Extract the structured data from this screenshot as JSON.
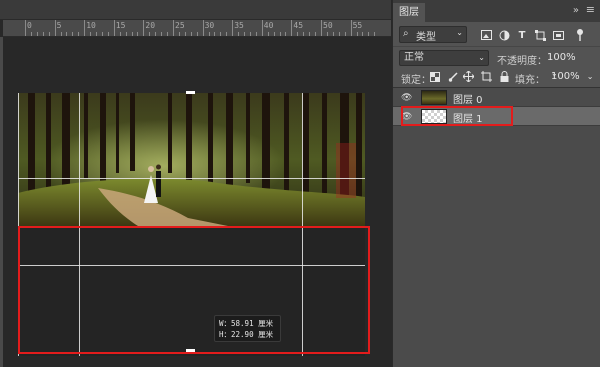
{
  "rulers": {
    "horizontal_labels": [
      "0",
      "5",
      "10",
      "15",
      "20",
      "25",
      "30",
      "35",
      "40",
      "45",
      "50",
      "55"
    ]
  },
  "size_tooltip": {
    "width_label": "W：",
    "width_value": "58.91 厘米",
    "height_label": "H：",
    "height_value": "22.90 厘米"
  },
  "panel": {
    "tab_label": "图层",
    "collapse_icon": "double-chevron-right-icon",
    "menu_icon": "panel-menu-icon",
    "filter": {
      "kind_label": "类型",
      "icons": [
        "image-filter-icon",
        "adjustment-filter-icon",
        "text-filter-icon",
        "shape-filter-icon",
        "smart-object-filter-icon",
        "filter-toggle-icon"
      ]
    },
    "blend_mode": "正常",
    "opacity_label": "不透明度：",
    "opacity_value": "100%",
    "lock_label": "锁定：",
    "lock_icons": [
      "lock-transparent-pixels-icon",
      "lock-image-pixels-icon",
      "lock-position-icon",
      "lock-artboard-icon",
      "lock-all-icon"
    ],
    "fill_label": "填充：",
    "fill_value": "100%",
    "layers": [
      {
        "name": "图层 0",
        "visible": true,
        "thumbnail": "photo",
        "selected": false
      },
      {
        "name": "图层 1",
        "visible": true,
        "thumbnail": "transparent",
        "selected": true
      }
    ]
  },
  "colors": {
    "highlight_red": "#e31c1c",
    "panel_bg": "#535353",
    "canvas_bg": "#282828"
  }
}
